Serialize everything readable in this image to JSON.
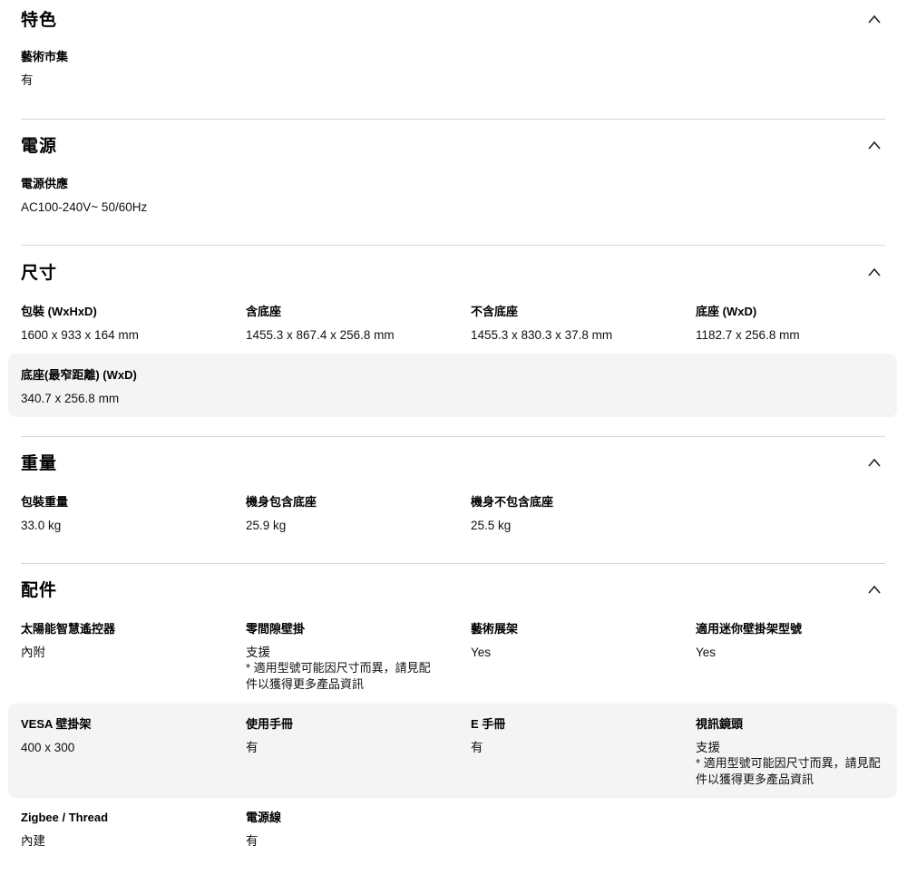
{
  "sections": {
    "features": {
      "title": "特色",
      "rows": [
        [
          {
            "label": "藝術市集",
            "value": "有"
          }
        ]
      ]
    },
    "power": {
      "title": "電源",
      "rows": [
        [
          {
            "label": "電源供應",
            "value": "AC100-240V~ 50/60Hz"
          }
        ]
      ]
    },
    "dimensions": {
      "title": "尺寸",
      "rows": [
        [
          {
            "label": "包裝 (WxHxD)",
            "value": "1600 x 933 x 164 mm"
          },
          {
            "label": "含底座",
            "value": "1455.3 x 867.4 x 256.8 mm"
          },
          {
            "label": "不含底座",
            "value": "1455.3 x 830.3 x 37.8 mm"
          },
          {
            "label": "底座 (WxD)",
            "value": "1182.7 x 256.8 mm"
          }
        ],
        [
          {
            "label": "底座(最窄距離) (WxD)",
            "value": "340.7 x 256.8 mm"
          }
        ]
      ]
    },
    "weight": {
      "title": "重量",
      "rows": [
        [
          {
            "label": "包裝重量",
            "value": "33.0 kg"
          },
          {
            "label": "機身包含底座",
            "value": "25.9 kg"
          },
          {
            "label": "機身不包含底座",
            "value": "25.5 kg"
          }
        ]
      ]
    },
    "accessories": {
      "title": "配件",
      "rows": [
        [
          {
            "label": "太陽能智慧遙控器",
            "value": "內附"
          },
          {
            "label": "零間隙壁掛",
            "value": "支援",
            "note": "* 適用型號可能因尺寸而異，請見配件以獲得更多產品資訊"
          },
          {
            "label": "藝術展架",
            "value": "Yes"
          },
          {
            "label": "適用迷你壁掛架型號",
            "value": "Yes"
          }
        ],
        [
          {
            "label": "VESA 壁掛架",
            "value": "400 x 300"
          },
          {
            "label": "使用手冊",
            "value": "有"
          },
          {
            "label": "E 手冊",
            "value": "有"
          },
          {
            "label": "視訊鏡頭",
            "value": "支援",
            "note": "* 適用型號可能因尺寸而異，請見配件以獲得更多產品資訊"
          }
        ],
        [
          {
            "label": "Zigbee / Thread",
            "value": "內建"
          },
          {
            "label": "電源線",
            "value": "有"
          }
        ]
      ]
    }
  },
  "icons": {
    "collapse": "chevron-up-icon"
  },
  "colors": {
    "divider": "#d8d8d8",
    "shaded_row": "#f4f4f4"
  }
}
